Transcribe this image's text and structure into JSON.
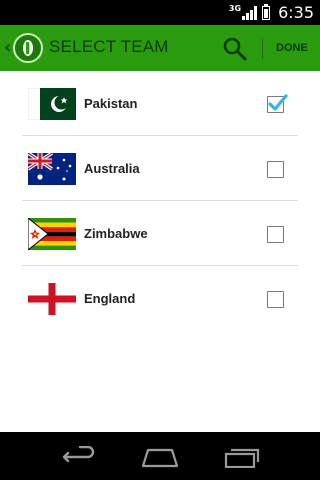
{
  "status_bar": {
    "network": "3G",
    "time": "6:35"
  },
  "app_bar": {
    "title": "SELECT TEAM",
    "done_label": "DONE",
    "accent_color": "#2a9a0e",
    "icons": [
      "up-chevron-icon",
      "app-logo-icon",
      "search-icon"
    ]
  },
  "teams": [
    {
      "name": "Pakistan",
      "flag": "pakistan-flag-icon",
      "checked": true
    },
    {
      "name": "Australia",
      "flag": "australia-flag-icon",
      "checked": false
    },
    {
      "name": "Zimbabwe",
      "flag": "zimbabwe-flag-icon",
      "checked": false
    },
    {
      "name": "England",
      "flag": "england-flag-icon",
      "checked": false
    }
  ],
  "nav_bar": {
    "icons": [
      "back-icon",
      "home-icon",
      "recent-apps-icon"
    ]
  },
  "colors": {
    "check_blue": "#33b5e5",
    "app_bar": "#2a9a0e"
  }
}
